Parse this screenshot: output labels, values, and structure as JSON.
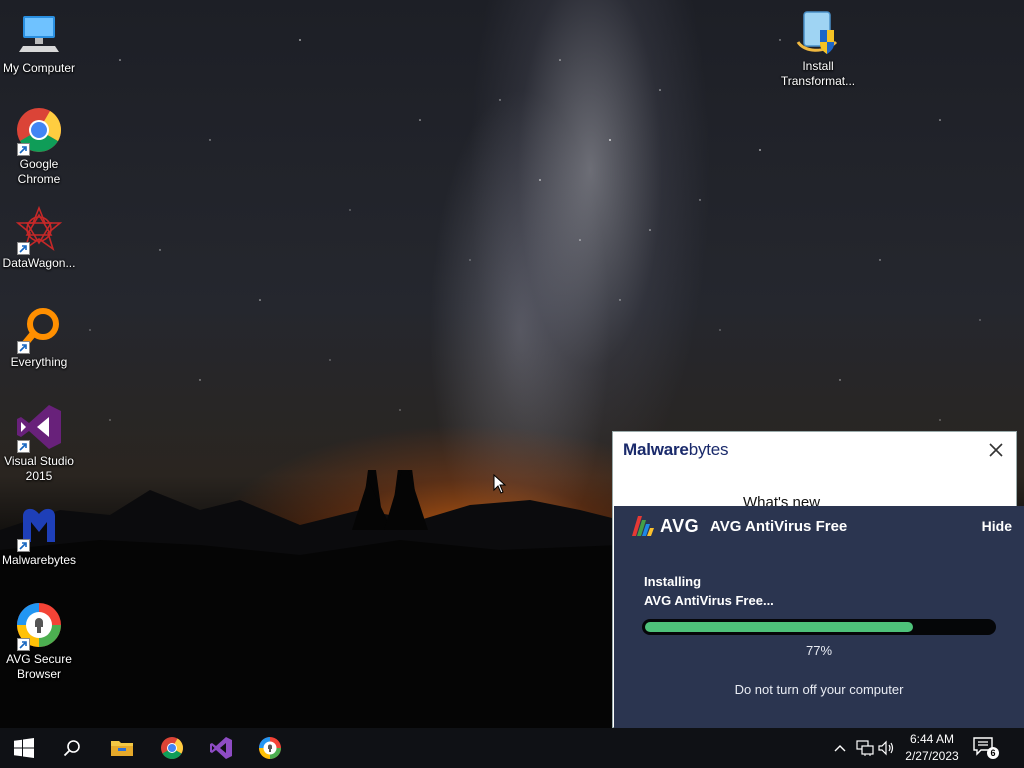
{
  "desktop": {
    "icons": [
      {
        "label": "My Computer"
      },
      {
        "label": "Google\nChrome"
      },
      {
        "label": "DataWagon..."
      },
      {
        "label": "Everything"
      },
      {
        "label": "Visual Studio\n2015"
      },
      {
        "label": "Malwarebytes"
      },
      {
        "label": "AVG Secure\nBrowser"
      },
      {
        "label": "Install\nTransformat..."
      }
    ]
  },
  "malwarebytes": {
    "logo_bold": "Malware",
    "logo_light": "bytes",
    "heading": "What's new",
    "close_icon": "close-icon"
  },
  "avg_installer": {
    "logo_text": "AVG",
    "title": "AVG AntiVirus Free",
    "hide_label": "Hide",
    "status_line1": "Installing",
    "status_line2": "AVG AntiVirus Free...",
    "progress": 0.77,
    "progress_label": "77%",
    "note": "Do not turn off your computer",
    "colors": {
      "panel": "#2b3550",
      "progress": "#4ec27a"
    }
  },
  "taskbar": {
    "pinned": [
      "windows-start-icon",
      "search-icon",
      "file-explorer-icon",
      "chrome-icon",
      "visual-studio-icon",
      "avg-secure-browser-icon"
    ],
    "tray": [
      "chevron-up-icon",
      "network-icon",
      "volume-icon"
    ],
    "time": "6:44 AM",
    "date": "2/27/2023",
    "notification_count": "6"
  }
}
